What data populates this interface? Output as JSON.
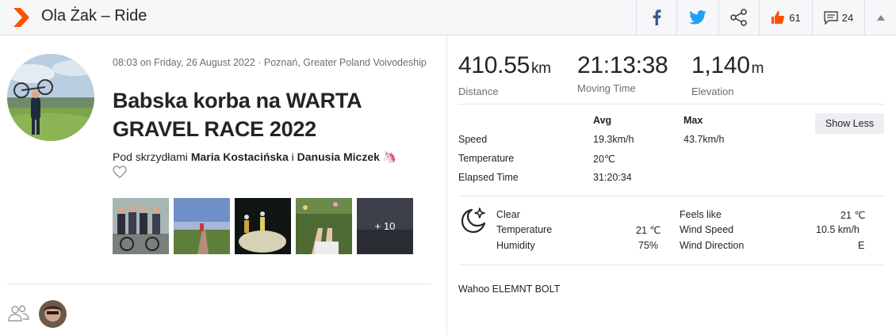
{
  "header": {
    "title": "Ola Żak – Ride",
    "kudos_count": "61",
    "comments_count": "24"
  },
  "activity": {
    "meta": "08:03 on Friday, 26 August 2022 · Poznań, Greater Poland Voivodeship",
    "title": "Babska korba na WARTA GRAVEL RACE 2022",
    "desc_prefix": "Pod skrzydłami ",
    "desc_name1": "Maria Kostacińska",
    "desc_mid": " i ",
    "desc_name2": "Danusia Miczek",
    "desc_emoji": " 🦄",
    "more_photos": "+ 10"
  },
  "stats": {
    "distance": {
      "value": "410.55",
      "unit": "km",
      "label": "Distance"
    },
    "moving_time": {
      "value": "21:13:38",
      "label": "Moving Time"
    },
    "elevation": {
      "value": "1,140",
      "unit": "m",
      "label": "Elevation"
    }
  },
  "details": {
    "col_avg": "Avg",
    "col_max": "Max",
    "show_less": "Show Less",
    "rows": [
      {
        "label": "Speed",
        "avg": "19.3km/h",
        "max": "43.7km/h"
      },
      {
        "label": "Temperature",
        "avg": "20℃",
        "max": ""
      },
      {
        "label": "Elapsed Time",
        "avg": "31:20:34",
        "max": ""
      }
    ]
  },
  "weather": {
    "condition": "Clear",
    "temperature_label": "Temperature",
    "temperature_value": "21 ℃",
    "humidity_label": "Humidity",
    "humidity_value": "75%",
    "feels_like_label": "Feels like",
    "feels_like_value": "21 ℃",
    "wind_speed_label": "Wind Speed",
    "wind_speed_value": "10.5 km/h",
    "wind_direction_label": "Wind Direction",
    "wind_direction_value": "E"
  },
  "device": "Wahoo ELEMNT BOLT",
  "colors": {
    "brand": "#fc5200",
    "facebook": "#3b5998",
    "twitter": "#1da1f2"
  }
}
